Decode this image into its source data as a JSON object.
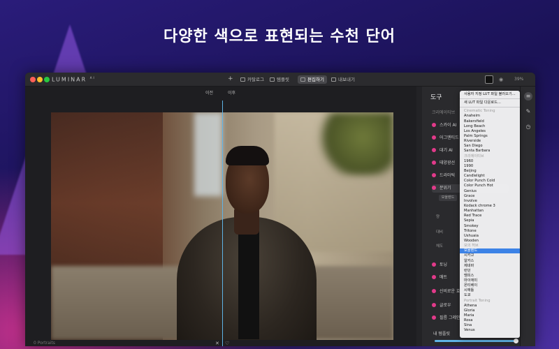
{
  "headline": "다양한 색으로 표현되는 수천 단어",
  "app": {
    "name": "LUMINAR",
    "version": "AI",
    "toolbar": {
      "add": "+",
      "catalog": "카탈로그",
      "template": "템플릿",
      "edit": "편집하기",
      "export": "내보내기",
      "zoom": "39%"
    }
  },
  "canvas": {
    "before": "이전",
    "after": "이후",
    "footer_left": "0 Portraits"
  },
  "panel": {
    "title": "도구",
    "sections": [
      {
        "label": "크리에이티브",
        "type": "header"
      },
      {
        "label": "스카이 AI"
      },
      {
        "label": "어그멘티드"
      },
      {
        "label": "대기 AI"
      },
      {
        "label": "태양광선"
      },
      {
        "label": "드라마틱"
      },
      {
        "label": "분위기",
        "selected": true
      }
    ],
    "sub_select": "모울렌드",
    "sub_items": [
      "양",
      "대비",
      "채도"
    ],
    "lower_tools": [
      "토닝",
      "매트",
      "신비로운 효",
      "글로우",
      "필름 그레인"
    ],
    "favorite": "내 템플릿",
    "slider_value": 1.0
  },
  "menu": {
    "items": [
      {
        "label": "사용자 지정 LUT 파일 불러오기...",
        "type": "item"
      },
      {
        "type": "separator"
      },
      {
        "label": "새 LUT 파일 다운로드...",
        "type": "item"
      },
      {
        "type": "separator"
      },
      {
        "label": "Cinematic Toning",
        "type": "header"
      },
      {
        "label": "Anaheim"
      },
      {
        "label": "Bakersfield"
      },
      {
        "label": "Long Beach"
      },
      {
        "label": "Los Angeles"
      },
      {
        "label": "Palm Springs"
      },
      {
        "label": "Riverside"
      },
      {
        "label": "San Diego"
      },
      {
        "label": "Santa Barbara"
      },
      {
        "label": "크리에이티브",
        "type": "header"
      },
      {
        "label": "1960"
      },
      {
        "label": "1990"
      },
      {
        "label": "Beijing"
      },
      {
        "label": "Candlelight"
      },
      {
        "label": "Color Punch Cold"
      },
      {
        "label": "Color Punch Hot"
      },
      {
        "label": "Genius"
      },
      {
        "label": "Grace"
      },
      {
        "label": "Involve"
      },
      {
        "label": "Kodack chrome  3"
      },
      {
        "label": "Manhattan"
      },
      {
        "label": "Red Trace"
      },
      {
        "label": "Sepia"
      },
      {
        "label": "Smokey"
      },
      {
        "label": "Tritone"
      },
      {
        "label": "Ushuaia"
      },
      {
        "label": "Wooden"
      },
      {
        "label": "모의 허브",
        "type": "header"
      },
      {
        "label": "모울렌드",
        "highlighted": true
      },
      {
        "label": "시카고"
      },
      {
        "label": "알카스"
      },
      {
        "label": "제네바"
      },
      {
        "label": "런던"
      },
      {
        "label": "멤피스"
      },
      {
        "label": "마이애미"
      },
      {
        "label": "몬티베이"
      },
      {
        "label": "시애틀"
      },
      {
        "label": "도쿄"
      },
      {
        "label": "Portrait Toning",
        "type": "header"
      },
      {
        "label": "Athena"
      },
      {
        "label": "Gloria"
      },
      {
        "label": "Maria"
      },
      {
        "label": "Rosa"
      },
      {
        "label": "Sina"
      },
      {
        "label": "Venus"
      }
    ]
  },
  "colors": {
    "accent": "#5fb4e6",
    "menu_highlight": "#3c82e6",
    "tool_icon": "#e23a8a"
  }
}
